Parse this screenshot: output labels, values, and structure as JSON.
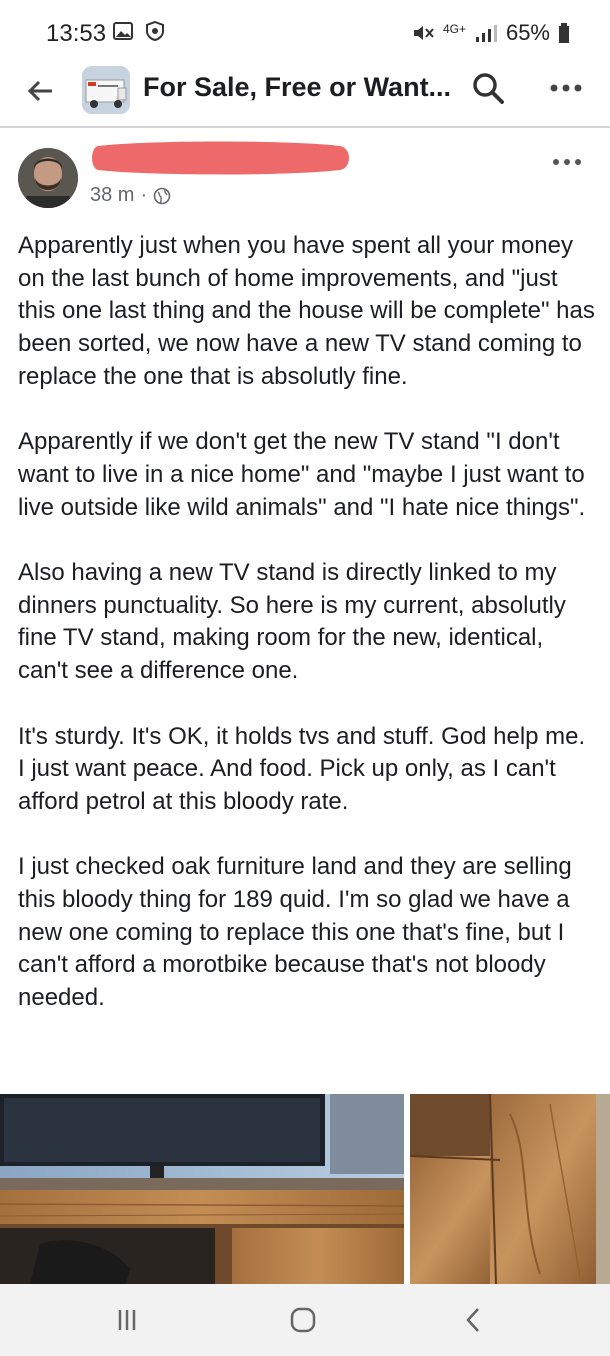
{
  "status_bar": {
    "time": "13:53",
    "network": "4G+",
    "battery": "65%",
    "icons": [
      "gallery-icon",
      "shield-icon",
      "mute-icon",
      "signal-icon",
      "battery-icon"
    ]
  },
  "header": {
    "title": "For Sale, Free or Want...",
    "icons": [
      "back-arrow-icon",
      "search-icon",
      "more-icon"
    ]
  },
  "post": {
    "time_ago": "38 m",
    "separator": "·",
    "audience_icon": "globe-icon",
    "paragraphs": [
      "Apparently just when you have spent all your money on the last bunch of home improvements, and \"just this one last thing and the house will be complete\" has been sorted, we now have a new TV stand coming to replace the one that is absolutly fine.",
      "Apparently if we don't get the new TV stand \"I don't want to live in a nice home\" and \"maybe I just want to live outside like wild animals\" and \"I hate nice things\".",
      "Also having a new TV stand is directly linked to my dinners punctuality. So here is my current, absolutly fine TV stand, making room for the new, identical, can't see a difference one.",
      "It's sturdy. It's OK, it holds tvs and stuff. God help me. I just want peace. And food. Pick up only, as I can't afford petrol at this bloody rate.",
      "I just checked oak furniture land and they are selling this bloody thing for 189 quid. I'm so glad we have a new one coming to replace this one that's fine, but I can't afford a morotbike because that's not bloody needed."
    ]
  },
  "colors": {
    "text": "#1c1e21",
    "meta": "#65676b",
    "redaction": "#ee6a6a",
    "divider": "#d4d4d4",
    "nav_bg": "#f2f2f2"
  },
  "nav": {
    "icons": [
      "recent-apps-icon",
      "home-icon",
      "back-icon"
    ]
  }
}
